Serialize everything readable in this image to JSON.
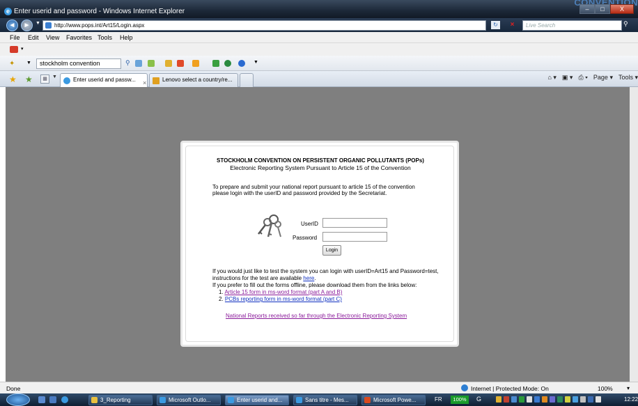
{
  "window": {
    "title": "Enter userid and password - Windows Internet Explorer",
    "corner_banner": "CONVENTION",
    "controls": [
      "–",
      "□",
      "X"
    ]
  },
  "address_bar": {
    "url": "http://www.pops.int/Art15/Login.aspx",
    "search_placeholder": "Live Search"
  },
  "menu": [
    "File",
    "Edit",
    "View",
    "Favorites",
    "Tools",
    "Help"
  ],
  "toolbar": {
    "search_value": "stockholm convention"
  },
  "tabs": [
    {
      "label": "Enter userid and passw...",
      "active": true
    },
    {
      "label": "Lenovo select a country/re...",
      "active": false
    }
  ],
  "command_bar": {
    "home": "⌂ ▾",
    "feeds": "▣ ▾",
    "print": "⎙ ▾",
    "page": "Page ▾",
    "tools": "Tools ▾"
  },
  "page": {
    "heading": "STOCKHOLM CONVENTION ON PERSISTENT ORGANIC POLLUTANTS (POPs)",
    "subheading": "Electronic Reporting System Pursuant to Article 15 of the Convention",
    "intro_line1": "To prepare and submit your national report pursuant to article 15 of the convention",
    "intro_line2": "please login with the userID and password provided by the Secretariat.",
    "userid_label": "UserID",
    "password_label": "Password",
    "login_button": "Login",
    "test_line1": "If you would just like to test the system you can login with userID=Art15 and Password=test,",
    "test_line2_prefix": "instructions for the test are available ",
    "test_line2_link": "here",
    "test_line2_suffix": ".",
    "offline_line": "If you prefer to fill out the forms offline, please download them from the links below:",
    "forms": [
      {
        "number": "1.",
        "label": "Article 15 form in ms-word format (part A and B)"
      },
      {
        "number": "2.",
        "label": "PCBs reporting form in ms-word format (part C)"
      }
    ],
    "national_reports_link": "National Reports received so far through the Electronic Reporting System"
  },
  "status": {
    "text": "Done",
    "zone": "Internet | Protected Mode: On",
    "zoom": "100%",
    "zoom_drop": "▾"
  },
  "taskbar": {
    "items": [
      {
        "label": "3_Reporting",
        "active": false
      },
      {
        "label": "Microsoft Outlo...",
        "active": false
      },
      {
        "label": "Enter userid and...",
        "active": true
      },
      {
        "label": "Sans titre - Mes...",
        "active": false
      },
      {
        "label": "Microsoft Powe...",
        "active": false
      }
    ],
    "language": "FR",
    "zoom_badge": "100%",
    "clock": "12:22"
  },
  "colors": {
    "visited_link": "#8a1a9a",
    "link": "#1030c0",
    "content_bg": "#7f7f7f"
  }
}
